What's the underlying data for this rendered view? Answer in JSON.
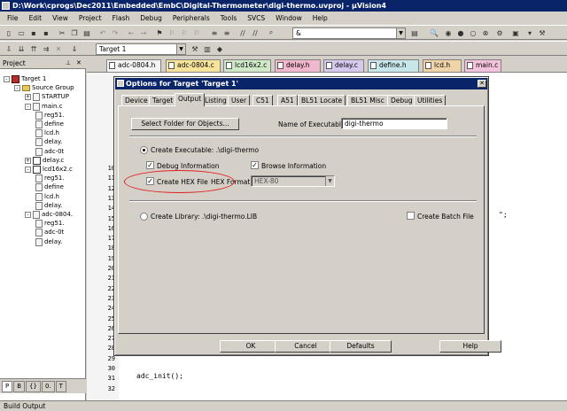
{
  "window": {
    "title": "D:\\Work\\cprogs\\Dec2011\\Embedded\\EmbC\\Digital-Thermometer\\digi-thermo.uvproj - µVision4"
  },
  "menu": [
    "File",
    "Edit",
    "View",
    "Project",
    "Flash",
    "Debug",
    "Peripherals",
    "Tools",
    "SVCS",
    "Window",
    "Help"
  ],
  "toolbar": {
    "search_value": "&",
    "target_select": "Target 1"
  },
  "project_panel": {
    "title": "Project",
    "tree": [
      {
        "label": "Target 1",
        "kind": "target",
        "exp": "-"
      },
      {
        "label": "Source Group",
        "kind": "folder",
        "exp": "-"
      },
      {
        "label": "STARTUP",
        "kind": "file",
        "exp": "+"
      },
      {
        "label": "main.c",
        "kind": "file",
        "exp": "-"
      },
      {
        "label": "reg51.",
        "kind": "file",
        "exp": ""
      },
      {
        "label": "define",
        "kind": "file",
        "exp": ""
      },
      {
        "label": "lcd.h",
        "kind": "file",
        "exp": ""
      },
      {
        "label": "delay.",
        "kind": "file",
        "exp": ""
      },
      {
        "label": "adc-0t",
        "kind": "file",
        "exp": ""
      },
      {
        "label": "delay.c",
        "kind": "key",
        "exp": "+"
      },
      {
        "label": "lcd16x2.c",
        "kind": "key",
        "exp": "-"
      },
      {
        "label": "reg51.",
        "kind": "file",
        "exp": ""
      },
      {
        "label": "define",
        "kind": "file",
        "exp": ""
      },
      {
        "label": "lcd.h",
        "kind": "file",
        "exp": ""
      },
      {
        "label": "delay.",
        "kind": "file",
        "exp": ""
      },
      {
        "label": "adc-0804.",
        "kind": "file",
        "exp": "-"
      },
      {
        "label": "reg51.",
        "kind": "file",
        "exp": ""
      },
      {
        "label": "adc-0t",
        "kind": "file",
        "exp": ""
      },
      {
        "label": "delay.",
        "kind": "file",
        "exp": ""
      }
    ],
    "tabs": [
      "P",
      "B",
      "{}",
      "0.",
      "T"
    ]
  },
  "editor": {
    "tabs": [
      {
        "label": "adc-0804.h",
        "color": "#f4f4f4"
      },
      {
        "label": "adc-0804.c",
        "color": "#f7e39a"
      },
      {
        "label": "lcd16x2.c",
        "color": "#cfe8c8"
      },
      {
        "label": "delay.h",
        "color": "#f1b7cc"
      },
      {
        "label": "delay.c",
        "color": "#d7c8ee"
      },
      {
        "label": "define.h",
        "color": "#c6e6ea"
      },
      {
        "label": "lcd.h",
        "color": "#f1d3a8"
      },
      {
        "label": "main.c",
        "color": "#f4c2dd"
      }
    ],
    "line_numbers": [
      "10",
      "11",
      "12",
      "13",
      "14",
      "15",
      "16",
      "17",
      "18",
      "19",
      "20",
      "21",
      "22",
      "23",
      "24",
      "25",
      "26",
      "27",
      "28",
      "29",
      "30",
      "31",
      "32"
    ],
    "code_line_31": "adc_init();",
    "code_line_32": "",
    "right_fragment": "\";"
  },
  "dialog": {
    "title": "Options for Target 'Target 1'",
    "tabs": [
      "Device",
      "Target",
      "Output",
      "Listing",
      "User",
      "C51",
      "A51",
      "BL51 Locate",
      "BL51 Misc",
      "Debug",
      "Utilities"
    ],
    "active_tab": "Output",
    "select_folder_btn": "Select Folder for Objects...",
    "name_exec_label": "Name of Executable:",
    "name_exec_value": "digi-thermo",
    "create_exec_label": "Create Executable:  .\\digi-thermo",
    "debug_info_label": "Debug Information",
    "browse_info_label": "Browse Information",
    "create_hex_label": "Create HEX File",
    "hex_format_label": "HEX Format:",
    "hex_format_value": "HEX-80",
    "create_lib_label": "Create Library:  .\\digi-thermo.LIB",
    "create_batch_label": "Create Batch File",
    "ok": "OK",
    "cancel": "Cancel",
    "defaults": "Defaults",
    "help": "Help",
    "highlight_color": "#e02020"
  },
  "status": {
    "build_output": "Build Output"
  }
}
